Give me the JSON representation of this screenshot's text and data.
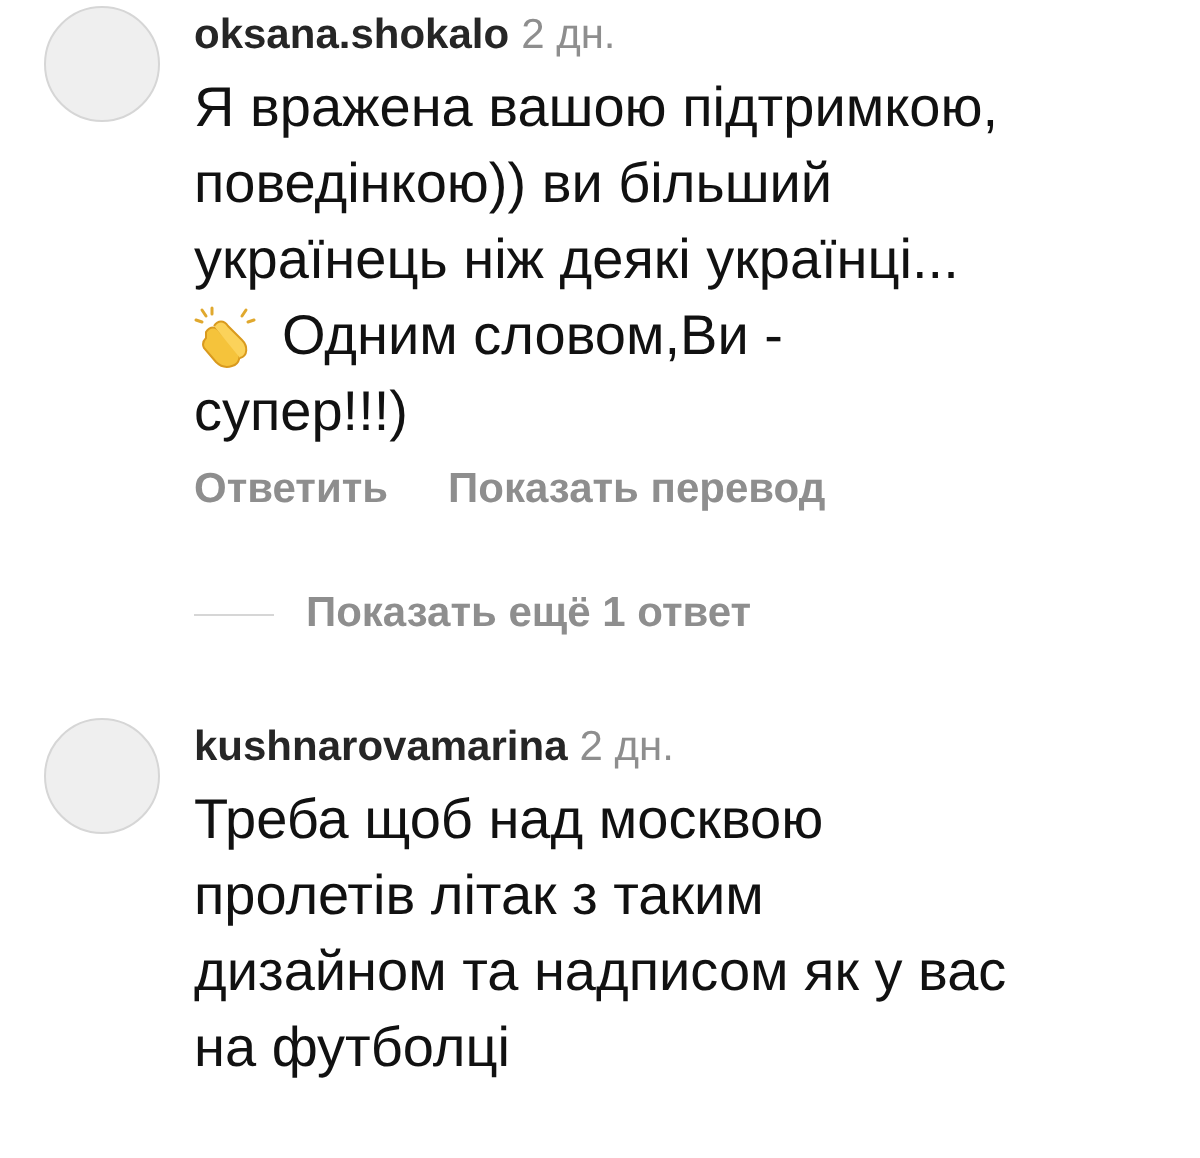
{
  "comments": [
    {
      "username": "oksana.shokalo",
      "time": "2 дн.",
      "text": "Я вражена вашою підтримкою,\nповедінкою)) ви більший\nукраїнець ніж деякі українці...\n",
      "text_after_icon": "Одним словом,Ви -",
      "text_end": "супер!!!)",
      "actions": [
        "Ответить",
        "Показать перевод"
      ],
      "more_replies": "Показать ещё 1 ответ"
    },
    {
      "username": "kushnarovamarina",
      "time": "2 дн.",
      "text": "Треба щоб над москвою\nпролетів літак з таким\nдизайном та надписом як у вас\nна футболці"
    }
  ]
}
